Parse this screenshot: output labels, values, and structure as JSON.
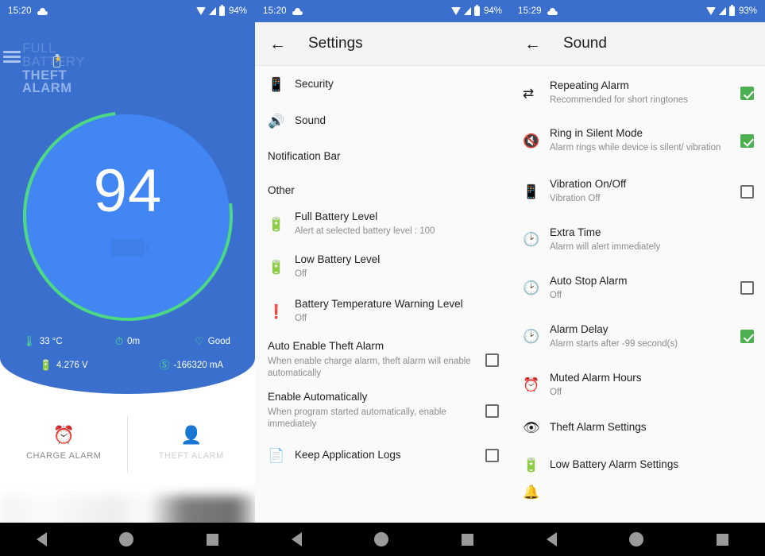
{
  "panel1": {
    "status": {
      "time": "15:20",
      "battery_pct": "94%",
      "cloud_icon": "cloud-icon",
      "wifi_icon": "wifi-icon",
      "signal_icon": "signal-icon",
      "battery_icon": "battery-icon"
    },
    "logo": {
      "line1": "FULL",
      "line2": "BATTERY",
      "line3": "THEFT",
      "line4": "ALARM"
    },
    "menu_icon": "hamburger-menu-icon",
    "gauge": {
      "value": "94",
      "battery_icon": "battery-fill-icon"
    },
    "stats": [
      {
        "icon": "thermometer-icon",
        "value": "33 °C"
      },
      {
        "icon": "timer-icon",
        "value": "0m"
      },
      {
        "icon": "heart-pulse-icon",
        "value": "Good"
      },
      {
        "icon": "battery-bolt-icon",
        "value": "4.276 V"
      },
      {
        "icon": "ammeter-icon",
        "value": "-166320 mA"
      }
    ],
    "tabs": [
      {
        "label": "CHARGE ALARM",
        "icon": "alarm-clock-bolt-icon",
        "active": true
      },
      {
        "label": "THEFT ALARM",
        "icon": "person-shield-icon",
        "active": false
      }
    ]
  },
  "panel2": {
    "status": {
      "time": "15:20",
      "battery_pct": "94%"
    },
    "appbar": {
      "title": "Settings",
      "back_icon": "back-arrow-icon"
    },
    "items": [
      {
        "type": "row",
        "icon": "phone-lock-icon",
        "title": "Security",
        "sub": "",
        "checkbox": null
      },
      {
        "type": "row",
        "icon": "speaker-icon",
        "title": "Sound",
        "sub": "",
        "checkbox": null
      },
      {
        "type": "section",
        "title": "Notification Bar"
      },
      {
        "type": "section",
        "title": "Other"
      },
      {
        "type": "row",
        "icon": "battery-bolt-icon",
        "title": "Full Battery Level",
        "sub": "Alert at selected battery level : 100",
        "checkbox": null
      },
      {
        "type": "row",
        "icon": "battery-alert-icon",
        "title": "Low Battery Level",
        "sub": "Off",
        "checkbox": null
      },
      {
        "type": "row",
        "icon": "warning-badge-icon",
        "title": "Battery Temperature Warning Level",
        "sub": "Off",
        "checkbox": null
      },
      {
        "type": "row",
        "icon": "",
        "title": "Auto Enable Theft Alarm",
        "sub": "When enable charge alarm, theft alarm will enable automatically",
        "checkbox": false
      },
      {
        "type": "row",
        "icon": "",
        "title": "Enable Automatically",
        "sub": "When program started automatically, enable immediately",
        "checkbox": false
      },
      {
        "type": "row",
        "icon": "document-icon",
        "title": "Keep Application Logs",
        "sub": "",
        "checkbox": false
      }
    ]
  },
  "panel3": {
    "status": {
      "time": "15:29",
      "battery_pct": "93%"
    },
    "appbar": {
      "title": "Sound",
      "back_icon": "back-arrow-icon"
    },
    "items": [
      {
        "icon": "repeat-icon",
        "title": "Repeating Alarm",
        "sub": "Recommended for short ringtones",
        "checkbox": true
      },
      {
        "icon": "speaker-mute-icon",
        "title": "Ring in Silent Mode",
        "sub": "Alarm rings while device is silent/ vibration",
        "checkbox": true
      },
      {
        "icon": "vibration-icon",
        "title": "Vibration On/Off",
        "sub": "Vibration Off",
        "checkbox": false
      },
      {
        "icon": "clock-icon",
        "title": "Extra Time",
        "sub": "Alarm will alert immediately",
        "checkbox": null
      },
      {
        "icon": "clock-icon",
        "title": "Auto Stop Alarm",
        "sub": "Off",
        "checkbox": false
      },
      {
        "icon": "clock-icon",
        "title": "Alarm Delay",
        "sub": "Alarm starts after -99 second(s)",
        "checkbox": true
      },
      {
        "icon": "alarm-off-icon",
        "title": "Muted Alarm Hours",
        "sub": "Off",
        "checkbox": null
      },
      {
        "icon": "eye-icon",
        "title": "Theft Alarm Settings",
        "sub": "",
        "checkbox": null
      },
      {
        "icon": "battery-alert-icon",
        "title": "Low Battery Alarm Settings",
        "sub": "",
        "checkbox": null
      }
    ]
  },
  "navbar": {
    "back_icon": "nav-back-icon",
    "home_icon": "nav-home-icon",
    "recents_icon": "nav-recents-icon"
  },
  "colors": {
    "blue": "#3b6fce",
    "blue_light": "#4286f4",
    "green": "#4cd884",
    "check_green": "#4caf50"
  }
}
